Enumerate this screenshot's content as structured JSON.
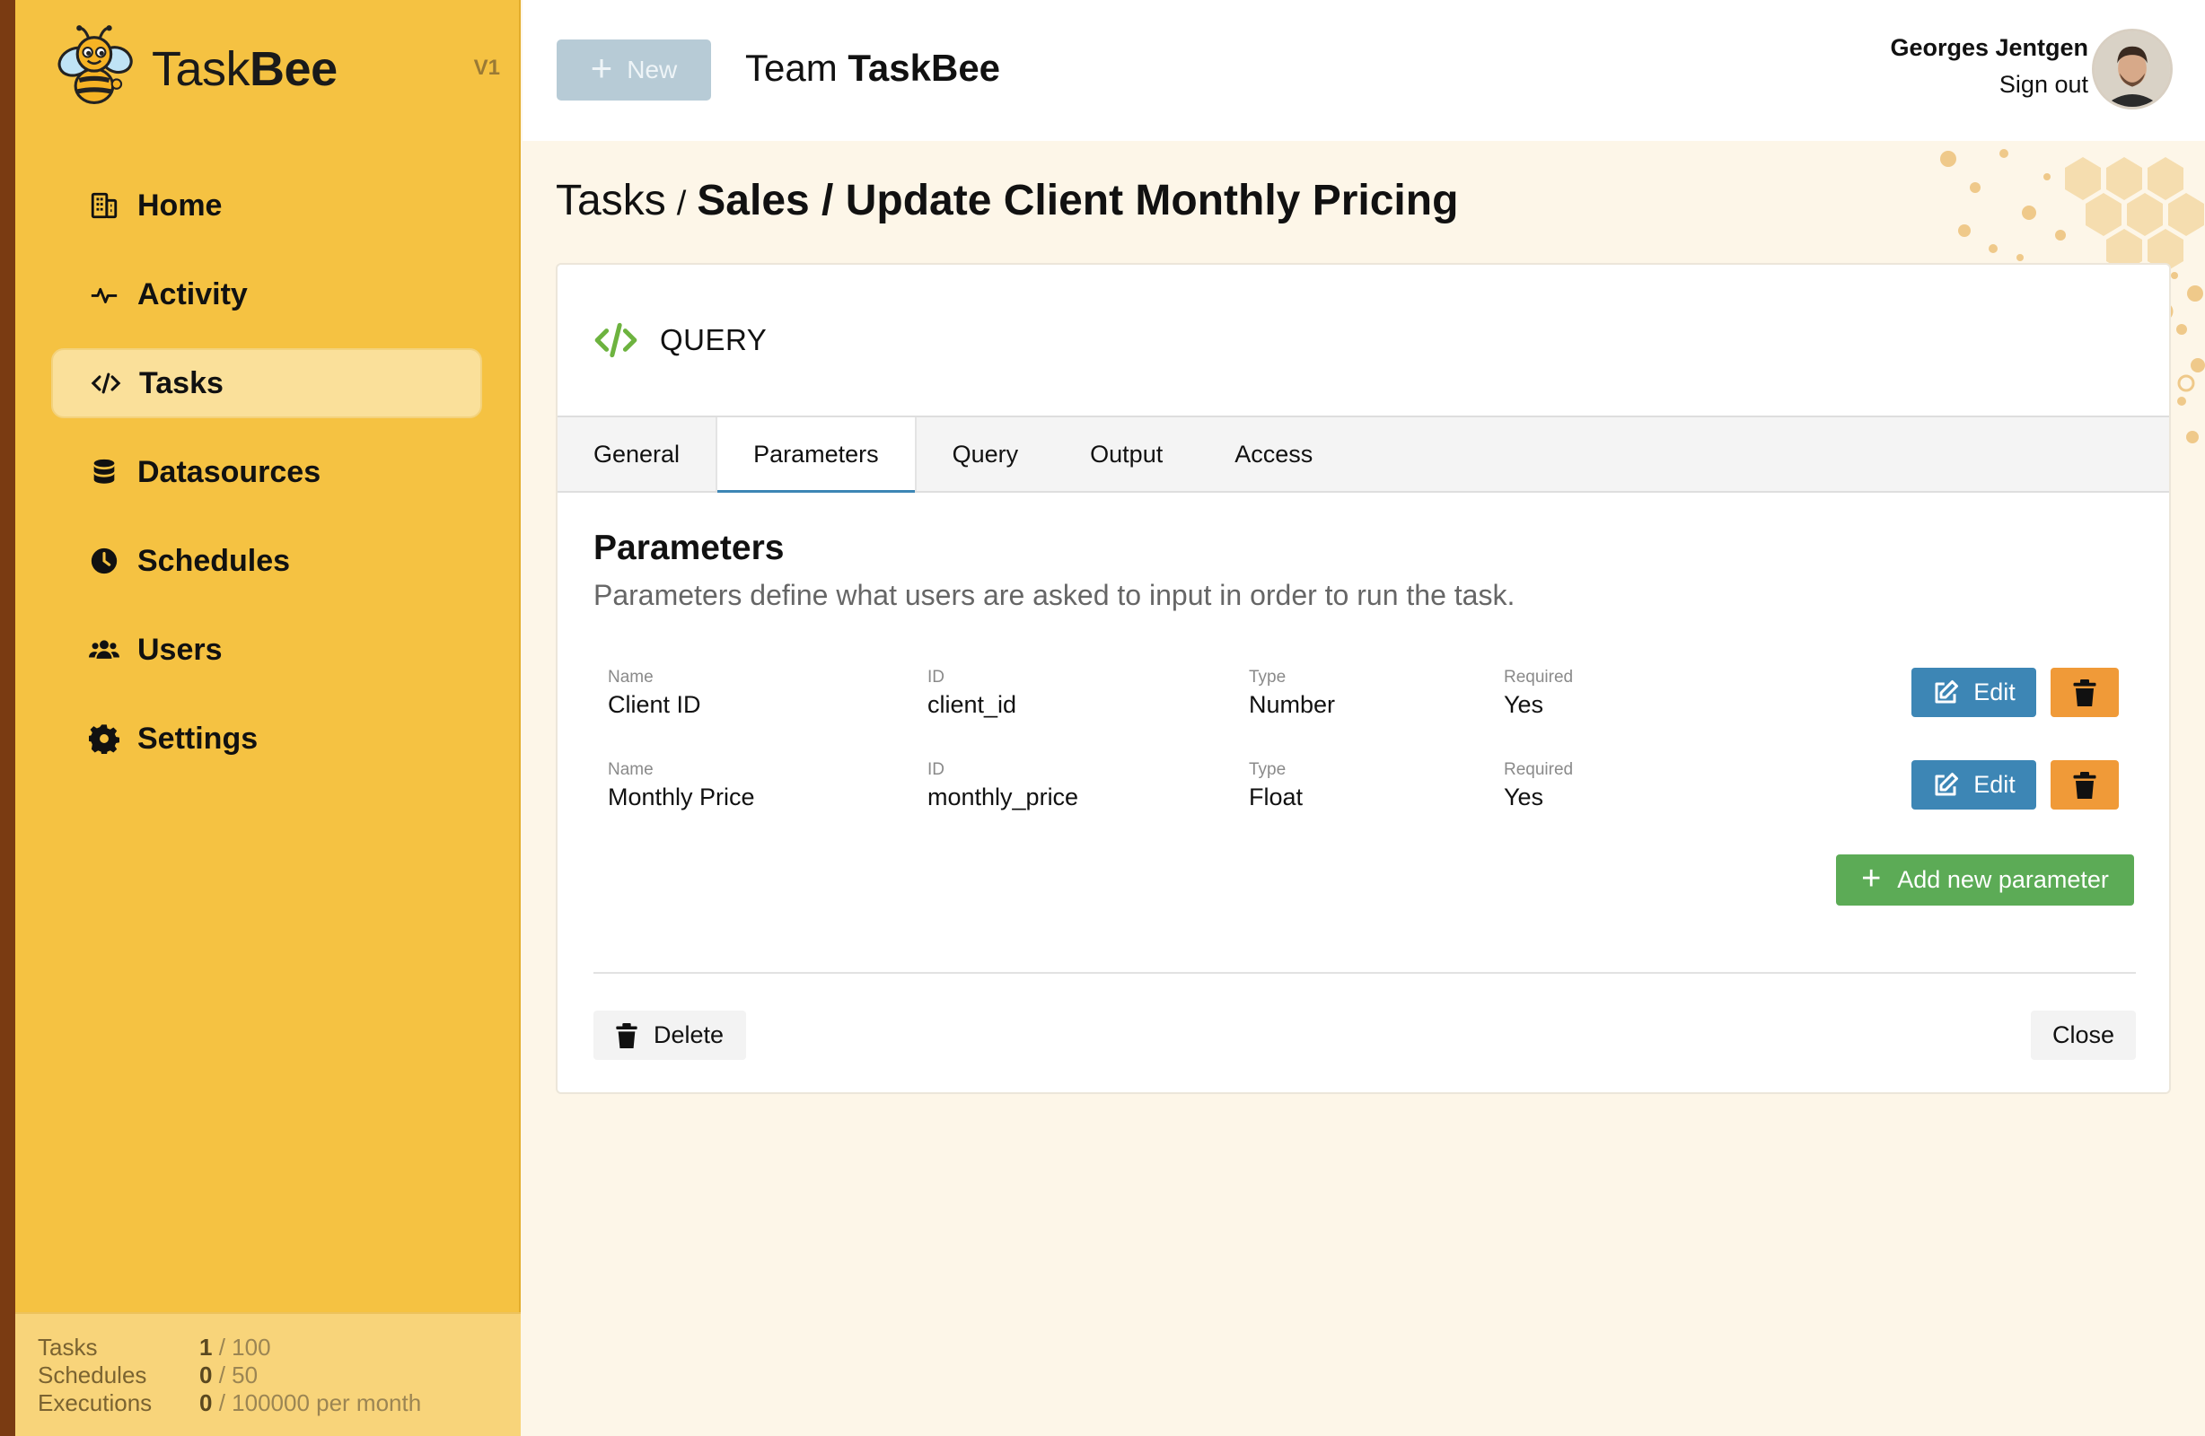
{
  "app": {
    "name_light": "Task",
    "name_bold": "Bee",
    "version": "V1"
  },
  "sidebar": {
    "items": [
      {
        "label": "Home",
        "icon": "building-icon"
      },
      {
        "label": "Activity",
        "icon": "pulse-icon"
      },
      {
        "label": "Tasks",
        "icon": "code-icon",
        "active": true
      },
      {
        "label": "Datasources",
        "icon": "database-icon"
      },
      {
        "label": "Schedules",
        "icon": "clock-icon"
      },
      {
        "label": "Users",
        "icon": "users-icon"
      },
      {
        "label": "Settings",
        "icon": "gear-icon"
      }
    ],
    "usage": [
      {
        "label": "Tasks",
        "used": "1",
        "limit": "/ 100"
      },
      {
        "label": "Schedules",
        "used": "0",
        "limit": "/ 50"
      },
      {
        "label": "Executions",
        "used": "0",
        "limit": "/ 100000 per month"
      }
    ]
  },
  "header": {
    "new_label": "New",
    "team_prefix": "Team",
    "team_name": "TaskBee",
    "user_name": "Georges Jentgen",
    "sign_out": "Sign out"
  },
  "breadcrumb": {
    "root": "Tasks",
    "separator": "/",
    "path": "Sales / Update Client Monthly Pricing"
  },
  "card": {
    "type_label": "QUERY",
    "tabs": [
      "General",
      "Parameters",
      "Query",
      "Output",
      "Access"
    ],
    "active_tab": "Parameters",
    "section_title": "Parameters",
    "section_desc": "Parameters define what users are asked to input in order to run the task.",
    "field_labels": {
      "name": "Name",
      "id": "ID",
      "type": "Type",
      "required": "Required"
    },
    "parameters": [
      {
        "name": "Client ID",
        "id": "client_id",
        "type": "Number",
        "required": "Yes"
      },
      {
        "name": "Monthly Price",
        "id": "monthly_price",
        "type": "Float",
        "required": "Yes"
      }
    ],
    "edit_label": "Edit",
    "add_label": "Add new parameter",
    "delete_label": "Delete",
    "close_label": "Close"
  },
  "colors": {
    "sidebar": "#f5c242",
    "accent_blue": "#3d86b5",
    "accent_green": "#5cab56",
    "accent_orange": "#f09a38",
    "query_icon": "#6db33f"
  }
}
